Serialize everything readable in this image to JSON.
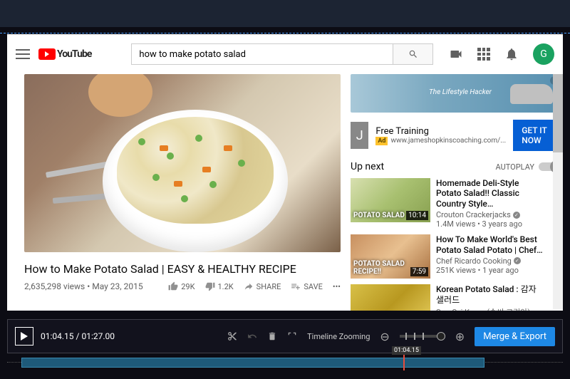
{
  "header": {
    "logo_text": "YouTube",
    "search_value": "how to make potato salad",
    "avatar_letter": "G"
  },
  "video": {
    "title": "How to Make Potato Salad | EASY & HEALTHY RECIPE",
    "views": "2,635,298 views",
    "date": "May 23, 2015",
    "likes": "29K",
    "dislikes": "1.2K",
    "share_label": "SHARE",
    "save_label": "SAVE"
  },
  "ad": {
    "banner_text": "The Lifestyle Hacker",
    "logo_letter": "J",
    "title": "Free Training",
    "badge": "Ad",
    "url": "www.jameshopkinscoaching.com/...",
    "cta": "GET IT NOW",
    "info_icon": "i"
  },
  "sidebar": {
    "upnext_label": "Up next",
    "autoplay_label": "AUTOPLAY",
    "items": [
      {
        "title": "Homemade Deli-Style Potato Salad!! Classic Country Style…",
        "channel": "Crouton Crackerjacks",
        "meta": "1.4M views • 3 years ago",
        "duration": "10:14",
        "overlay": "POTATO SALAD"
      },
      {
        "title": "How To Make World's Best Potato Salad Potato | Chef…",
        "channel": "Chef Ricardo Cooking",
        "meta": "251K views • 1 year ago",
        "duration": "7:59",
        "overlay": "POTATO SALAD RECIPE!!"
      },
      {
        "title": "Korean Potato Salad : 감자 샐러드",
        "channel": "SomSsi Korea (솜씨 코리아)",
        "meta": "",
        "duration": "",
        "overlay": ""
      }
    ]
  },
  "editor": {
    "current_time": "01:04.15",
    "total_time": "01:27.00",
    "time_sep": " / ",
    "zoom_label": "Timeline Zooming",
    "merge_label": "Merge & Export",
    "playhead_label": "01:04.15"
  }
}
